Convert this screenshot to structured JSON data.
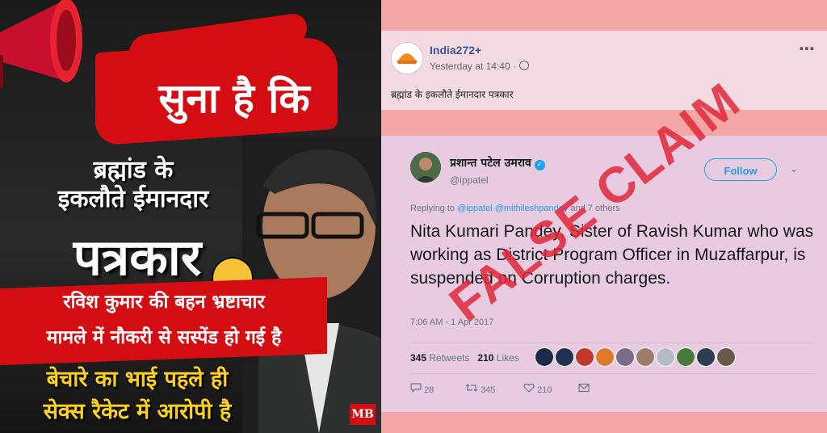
{
  "poster": {
    "headline": "सुना है कि",
    "line1a": "ब्रह्मांड के",
    "line1b": "इकलौते ईमानदार",
    "line2": "पत्रकार",
    "red_line1": "रविश कुमार की बहन भ्रष्टाचार",
    "red_line2": "मामले में नौकरी से सस्पेंड हो गई है",
    "yellow_line1": "बेचारे का भाई पहले ही",
    "yellow_line2": "सेक्स रैकेट में आरोपी है",
    "logo": "MB"
  },
  "fb_post": {
    "page_name": "India272+",
    "timestamp": "Yesterday at 14:40 ·",
    "text": "ब्रह्मांड के इकलौते ईमानदार पत्रकार",
    "more_icon": "⋯"
  },
  "tweet": {
    "display_name": "प्रशान्त पटेल उमराव",
    "handle": "@ippatel",
    "follow_label": "Follow",
    "chevron": "⌄",
    "replying_prefix": "Replying to ",
    "replying_users": "@ippatel @mithileshpandey",
    "replying_suffix": " and 7 others",
    "body": "Nita Kumari Pandey, Sister of Ravish Kumar who was working as District Program Officer in Muzaffarpur,  is suspended on Corruption charges.",
    "time": "7:06 AM - 1 Apr 2017",
    "retweets_count": "345",
    "retweets_label": "Retweets",
    "likes_count": "210",
    "likes_label": "Likes",
    "reply_count": "28",
    "retweet_action_count": "345",
    "like_action_count": "210"
  },
  "overlay": {
    "stamp_text": "FALSE CLAIM",
    "stamp_color": "#e2283a"
  },
  "colors": {
    "poster_red": "#d40d12",
    "poster_yellow": "#ffd21a",
    "twitter_blue": "#1da1f2",
    "fb_blue": "#3b5998",
    "panel_bg": "#f4a5a5"
  }
}
